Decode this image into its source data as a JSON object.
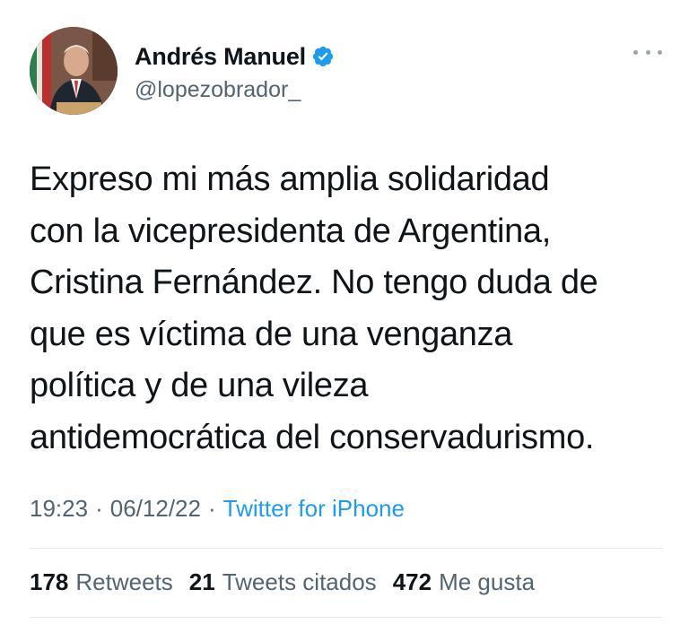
{
  "author": {
    "display_name": "Andrés Manuel",
    "handle": "@lopezobrador_",
    "verified": true
  },
  "tweet": {
    "text": "Expreso mi más amplia solidaridad\ncon la vicepresidenta de Argentina,\nCristina Fernández. No tengo duda de\nque es víctima de una venganza\npolítica y de una vileza\nantidemocrática del conservadurismo."
  },
  "meta": {
    "time": "19:23",
    "separator": "·",
    "date": "06/12/22",
    "source": "Twitter for iPhone"
  },
  "stats": {
    "retweets_count": "178",
    "retweets_label": "Retweets",
    "quotes_count": "21",
    "quotes_label": "Tweets citados",
    "likes_count": "472",
    "likes_label": "Me gusta"
  },
  "colors": {
    "text": "#0f1419",
    "secondary": "#536471",
    "link": "#1d9bf0",
    "verified": "#1d9bf0",
    "divider": "#e3e8ec"
  },
  "icons": {
    "verified": "verified-badge-icon",
    "more": "more-options-icon"
  }
}
